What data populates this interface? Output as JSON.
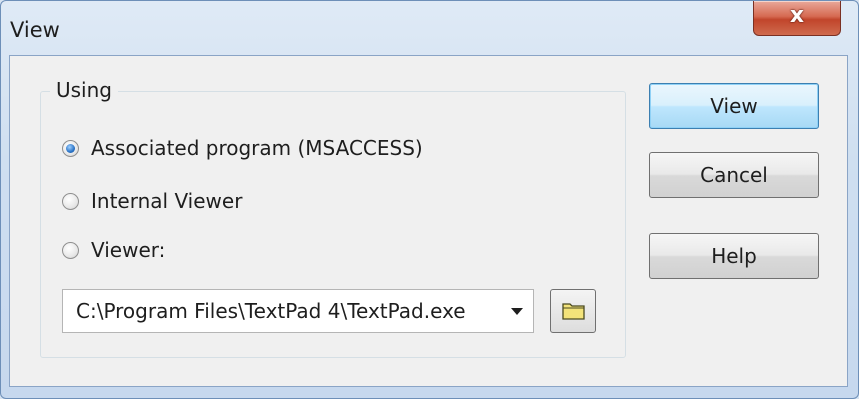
{
  "window": {
    "title": "View",
    "close_glyph": "x"
  },
  "using_group": {
    "label": "Using",
    "options": [
      {
        "label": "Associated program (MSACCESS)",
        "checked": true
      },
      {
        "label": "Internal Viewer",
        "checked": false
      },
      {
        "label": "Viewer:",
        "checked": false
      }
    ],
    "viewer_path": "C:\\Program Files\\TextPad 4\\TextPad.exe",
    "browse_icon": "folder-icon"
  },
  "buttons": {
    "view": "View",
    "cancel": "Cancel",
    "help": "Help"
  }
}
